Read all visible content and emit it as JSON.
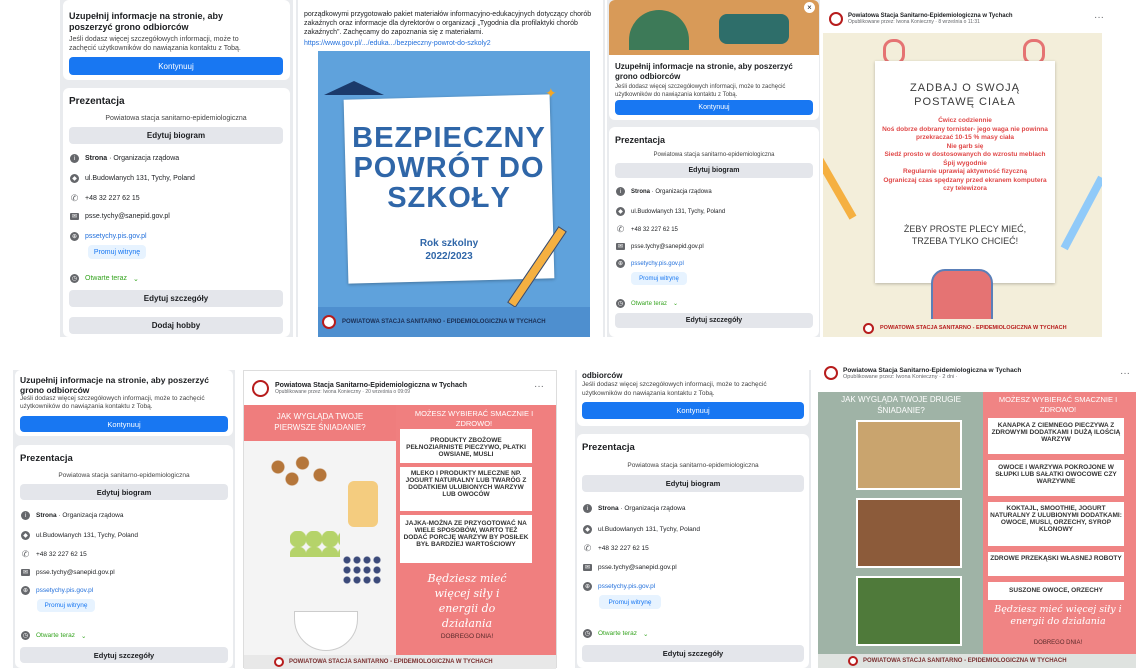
{
  "fb_cta": {
    "title": "Uzupełnij informacje na stronie, aby poszerzyć grono odbiorców",
    "desc": "Jeśli dodasz więcej szczegółowych informacji, może to zachęcić użytkowników do nawiązania kontaktu z Tobą.",
    "title_short": "odbiorców",
    "continue": "Kontynuuj"
  },
  "intro": {
    "heading": "Prezentacja",
    "bio": "Powiatowa stacja sanitarno-epidemiologiczna",
    "edit_bio": "Edytuj biogram",
    "type_bold": "Strona",
    "type_rest": " · Organizacja rządowa",
    "address": "ul.Budowlanych 131, Tychy, Poland",
    "phone": "+48 32 227 62 15",
    "email": "psse.tychy@sanepid.gov.pl",
    "website": "pssetychy.pis.gov.pl",
    "promote": "Promuj witrynę",
    "hours": "Otwarte teraz",
    "edit_details": "Edytuj szczegóły",
    "add_hobby": "Dodaj hobby"
  },
  "post1": {
    "text1": "porządkowymi przygotowało pakiet materiałów informacyjno-edukacyjnych dotyczący chorób zakaźnych oraz informacje dla dyrektorów o organizacji „Tygodnia dla profilaktyki chorób zakaźnych”. Zachęcamy do zapoznania się z materiałami.",
    "link": "https://www.gov.pl/.../eduka.../bezpieczny-powrot-do-szkoly2",
    "poster_title": "BEZPIECZNY POWRÓT DO SZKOŁY",
    "poster_line1": "BEZPIECZNY",
    "poster_line2": "POWRÓT DO",
    "poster_line3": "SZKOŁY",
    "year_label": "Rok szkolny",
    "year": "2022/2023",
    "footer": "POWIATOWA STACJA SANITARNO - EPIDEMIOLOGICZNA W TYCHACH"
  },
  "post2": {
    "author": "Powiatowa Stacja Sanitarno-Epidemiologiczna w Tychach",
    "meta": "Opublikowane przez: Iwona Konieczny · 8 września o 11:31",
    "headline1": "ZADBAJ O SWOJĄ",
    "headline2": "POSTAWĘ CIAŁA",
    "tips": [
      "Ćwicz codziennie",
      "Noś dobrze dobrany tornister- jego waga nie powinna przekraczać 10-15 % masy ciała",
      "Nie garb się",
      "Siedź prosto w dostosowanych do wzrostu meblach",
      "Śpij wygodnie",
      "Regularnie uprawiaj aktywność fizyczną",
      "Ograniczaj czas spędzany przed ekranem komputera czy telewizora"
    ],
    "slogan1": "ŻEBY PROSTE PLECY MIEĆ,",
    "slogan2": "TRZEBA TYLKO CHCIEĆ!",
    "footer": "POWIATOWA STACJA SANITARNO - EPIDEMIOLOGICZNA W TYCHACH"
  },
  "post3": {
    "author": "Powiatowa Stacja Sanitarno-Epidemiologiczna w Tychach",
    "meta": "Opublikowane przez: Iwona Konieczny · 20 września o 09:09",
    "question": "JAK WYGLĄDA TWOJE PIERWSZE ŚNIADANIE?",
    "choose": "MOŻESZ WYBIERAĆ SMACZNIE I ZDROWO!",
    "items": [
      "PRODUKTY ZBOŻOWE PEŁNOZIARNISTE PIECZYWO, PŁATKI OWSIANE, MUSLI",
      "MLEKO I PRODUKTY MLECZNE NP. JOGURT NATURALNY LUB TWARÓG Z DODATKIEM ULUBIONYCH WARZYW LUB OWOCÓW",
      "JAJKA-MOŻNA ZE PRZYGOTOWAĆ NA WIELE SPOSOBÓW, WARTO TEŻ DODAĆ PORCJĘ WARZYW BY POSIŁEK BYŁ BARDZIEJ WARTOŚCIOWY"
    ],
    "energy": "Będziesz mieć więcej siły i energii do działania",
    "enjoy": "DOBREGO DNIA!",
    "footer": "POWIATOWA STACJA SANITARNO - EPIDEMIOLOGICZNA W TYCHACH"
  },
  "post4": {
    "author": "Powiatowa Stacja Sanitarno-Epidemiologiczna w Tychach",
    "meta": "Opublikowane przez: Iwona Konieczny · 2 dni ·",
    "question": "JAK WYGLĄDA TWOJE DRUGIE ŚNIADANIE?",
    "choose": "MOŻESZ WYBIERAĆ SMACZNIE I ZDROWO!",
    "items": [
      "KANAPKA Z CIEMNEGO PIECZYWA Z ZDROWYMI DODATKAMI I DUŻĄ ILOŚCIĄ WARZYW",
      "OWOCE I WARZYWA POKROJONE W SŁUPKI LUB SAŁATKI OWOCOWE CZY WARZYWNE",
      "KOKTAJL, SMOOTHIE, JOGURT NATURALNY Z ULUBIONYMI DODATKAMI: OWOCE, MUSLI, ORZECHY, SYROP KLONOWY",
      "ZDROWE PRZEKĄSKI WŁASNEJ ROBOTY",
      "SUSZONE OWOCE, ORZECHY"
    ],
    "energy": "Będziesz mieć więcej siły i energii do działania",
    "enjoy": "DOBREGO DNIA!",
    "footer": "POWIATOWA STACJA SANITARNO - EPIDEMIOLOGICZNA W TYCHACH"
  },
  "more": "···",
  "colors": {
    "fb_blue": "#1877f2",
    "poster_blue": "#5fa2dc",
    "poster_pink": "#f08080",
    "dark_red": "#b71c1c"
  }
}
